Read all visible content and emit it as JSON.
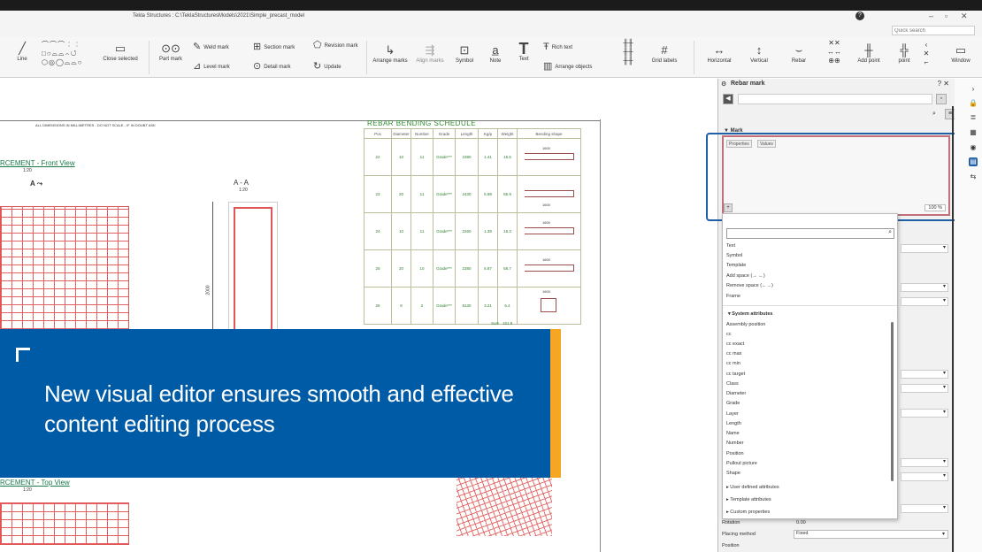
{
  "window": {
    "title": "Tekla Structures : C:\\TeklaStructuresModels\\2021\\Simple_precast_model",
    "quick_search_placeholder": "Quick search"
  },
  "ribbon": {
    "line": "Line",
    "close_selected": "Close selected",
    "part_mark": "Part mark",
    "weld_mark": "Weld mark",
    "level_mark": "Level mark",
    "section_mark": "Section mark",
    "detail_mark": "Detail mark",
    "revision_mark": "Revision mark",
    "update": "Update",
    "arrange_marks": "Arrange marks",
    "align_marks": "Align marks",
    "symbol": "Symbol",
    "note": "Note",
    "text": "Text",
    "rich_text": "Rich text",
    "arrange_objects": "Arrange objects",
    "grid_labels": "Grid labels",
    "horizontal": "Horizontal",
    "vertical": "Vertical",
    "rebar": "Rebar",
    "add_point": "Add point",
    "point": "point",
    "window": "Window"
  },
  "drawing": {
    "note": "ALL DIMENSIONS IN MILLIMETRES - DO NOT SCALE - IF IN DOUBT ASK",
    "front_view_label": "RCEMENT - Front View",
    "front_scale": "1:20",
    "section_a_marker": "A",
    "section_label": "A - A",
    "section_scale": "1:20",
    "section_dim": "2000",
    "top_view_label": "RCEMENT - Top View",
    "top_scale": "1:20",
    "schedule_title": "REBAR BENDING SCHEDULE",
    "schedule_headers": [
      "Pos",
      "Diameter",
      "Number",
      "Grade",
      "Length",
      "Kg/p",
      "Weight",
      "Bending shape"
    ],
    "schedule_rows": [
      {
        "pos": "22",
        "dia": "10",
        "num": "11",
        "grade": "Grade***",
        "len": "2380",
        "kgp": "1.41",
        "wt": "15.5",
        "dim": "1600"
      },
      {
        "pos": "23",
        "dia": "20",
        "num": "11",
        "grade": "Grade***",
        "len": "2430",
        "kgp": "5.99",
        "wt": "65.9",
        "dim": "1600"
      },
      {
        "pos": "24",
        "dia": "10",
        "num": "11",
        "grade": "Grade***",
        "len": "2260",
        "kgp": "1.39",
        "wt": "15.3",
        "dim": "1600"
      },
      {
        "pos": "25",
        "dia": "20",
        "num": "10",
        "grade": "Grade***",
        "len": "2380",
        "kgp": "5.87",
        "wt": "58.7",
        "dim": "1600"
      },
      {
        "pos": "26",
        "dia": "8",
        "num": "2",
        "grade": "Grade***",
        "len": "8130",
        "kgp": "3.21",
        "wt": "6.4",
        "dim": "1600"
      }
    ],
    "total_label": "Sum",
    "total_value": "161.8"
  },
  "banner": {
    "line1": "New visual editor ensures smooth and effective",
    "line2": "content editing process"
  },
  "panel": {
    "title": "Rebar mark",
    "mark_section": "Mark",
    "tab_properties": "Properties",
    "tab_values": "Values",
    "zoom": "100 %"
  },
  "dropdown": {
    "items": [
      "Text",
      "Symbol",
      "Template",
      "Add space  (→ ←)",
      "Remove space  (←→)",
      "Frame"
    ],
    "system_header": "System attributes",
    "system_items": [
      "Assembly position",
      "cc",
      "cc exact",
      "cc max",
      "cc min",
      "cc target",
      "Class",
      "Diameter",
      "Grade",
      "Layer",
      "Length",
      "Name",
      "Number",
      "Position",
      "Pullout picture",
      "Shape"
    ],
    "user_defined": "User defined attributes",
    "template_attrs": "Template attributes",
    "custom_props": "Custom properties"
  },
  "props": {
    "rotation_label": "Rotation",
    "rotation_value": "0.00",
    "placing_label": "Placing method",
    "placing_value": "Fixed",
    "position_label": "Position"
  }
}
